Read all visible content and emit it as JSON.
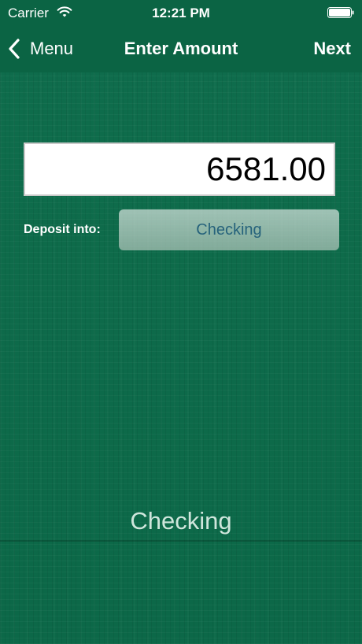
{
  "status_bar": {
    "carrier": "Carrier",
    "time": "12:21 PM"
  },
  "nav": {
    "back_label": "Menu",
    "title": "Enter Amount",
    "next_label": "Next"
  },
  "amount": {
    "value": "6581.00"
  },
  "deposit": {
    "label": "Deposit into:",
    "selected_account": "Checking"
  },
  "account_display": "Checking",
  "colors": {
    "background": "#0e6b4a",
    "bar": "#0b6444",
    "select_text": "#2e5f8e"
  }
}
